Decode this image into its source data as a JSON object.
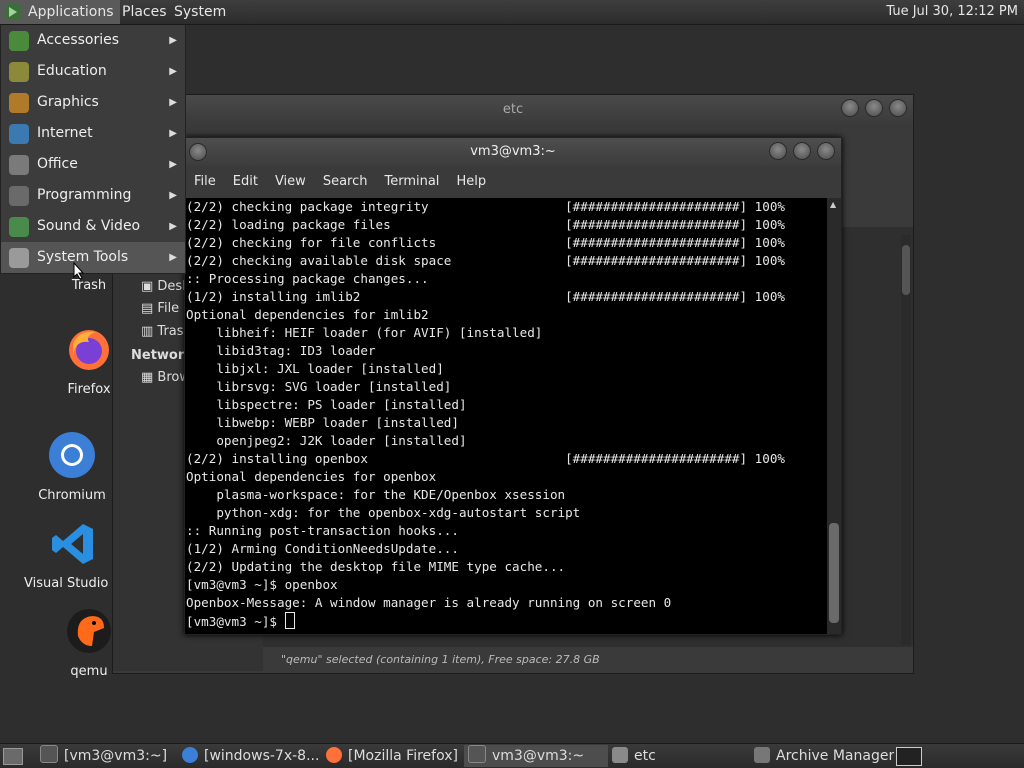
{
  "top_panel": {
    "applications": "Applications",
    "places": "Places",
    "system": "System",
    "clock": "Tue Jul 30, 12:12 PM"
  },
  "app_menu": {
    "items": [
      {
        "label": "Accessories",
        "icon": "accessories-icon"
      },
      {
        "label": "Education",
        "icon": "education-icon"
      },
      {
        "label": "Graphics",
        "icon": "graphics-icon"
      },
      {
        "label": "Internet",
        "icon": "internet-icon"
      },
      {
        "label": "Office",
        "icon": "office-icon"
      },
      {
        "label": "Programming",
        "icon": "programming-icon"
      },
      {
        "label": "Sound & Video",
        "icon": "sound-video-icon"
      },
      {
        "label": "System Tools",
        "icon": "system-tools-icon"
      }
    ]
  },
  "desktop_icons": [
    {
      "label": "Trash"
    },
    {
      "label": "Firefox"
    },
    {
      "label": "Chromium"
    },
    {
      "label": "Visual Studio Code"
    },
    {
      "label": "qemu"
    }
  ],
  "file_manager": {
    "title": "etc",
    "sidebar": {
      "items": [
        "Desktop",
        "File System",
        "Trash"
      ],
      "network_head": "Network",
      "network_items": [
        "Browse Network"
      ]
    },
    "status": "\"qemu\" selected (containing 1 item), Free space: 27.8 GB"
  },
  "terminal": {
    "title": "vm3@vm3:~",
    "menu": [
      "File",
      "Edit",
      "View",
      "Search",
      "Terminal",
      "Help"
    ],
    "lines": [
      "(2/2) checking package integrity                  [######################] 100%",
      "(2/2) loading package files                       [######################] 100%",
      "(2/2) checking for file conflicts                 [######################] 100%",
      "(2/2) checking available disk space               [######################] 100%",
      ":: Processing package changes...",
      "(1/2) installing imlib2                           [######################] 100%",
      "Optional dependencies for imlib2",
      "    libheif: HEIF loader (for AVIF) [installed]",
      "    libid3tag: ID3 loader",
      "    libjxl: JXL loader [installed]",
      "    librsvg: SVG loader [installed]",
      "    libspectre: PS loader [installed]",
      "    libwebp: WEBP loader [installed]",
      "    openjpeg2: J2K loader [installed]",
      "(2/2) installing openbox                          [######################] 100%",
      "Optional dependencies for openbox",
      "    plasma-workspace: for the KDE/Openbox xsession",
      "    python-xdg: for the openbox-xdg-autostart script",
      ":: Running post-transaction hooks...",
      "(1/2) Arming ConditionNeedsUpdate...",
      "(2/2) Updating the desktop file MIME type cache...",
      "[vm3@vm3 ~]$ openbox",
      "Openbox-Message: A window manager is already running on screen 0"
    ],
    "prompt": "[vm3@vm3 ~]$ "
  },
  "taskbar": {
    "tasks": [
      {
        "label": "[vm3@vm3:~]"
      },
      {
        "label": "[windows-7x-8..."
      },
      {
        "label": "[Mozilla Firefox]"
      },
      {
        "label": "vm3@vm3:~"
      },
      {
        "label": "etc"
      },
      {
        "label": "Archive Manager"
      }
    ]
  }
}
